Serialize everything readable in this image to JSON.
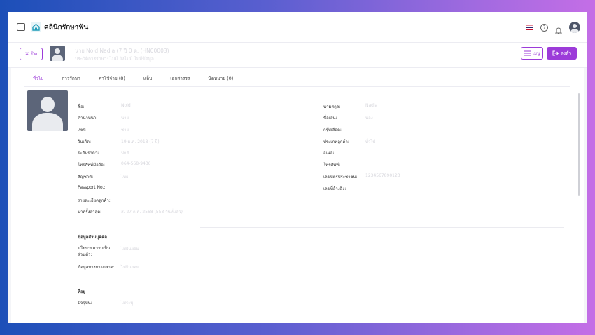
{
  "app": {
    "title": "คลินิกรักษาฟัน"
  },
  "header": {
    "icons": [
      "sidebar-toggle-icon",
      "home-icon",
      "thai-flag-icon",
      "help-icon",
      "bell-icon",
      "user-avatar-icon"
    ]
  },
  "patient": {
    "close_label": "ปิด",
    "name_line": "นาย Noid Nadia (7 ปี 0 ด. (HN00003)",
    "sub_line": "ประวัติการรักษา: ไม่มี ยังไม่มี ไม่มีข้อมูล",
    "menu_label": "เมนู",
    "send_label": "ส่งตัว"
  },
  "tabs": [
    "ทั่วไป",
    "การรักษา",
    "ค่าใช้จ่าย (8)",
    "แล็บ",
    "เอกสารรร",
    "นัดหมาย (0)"
  ],
  "fields_left": [
    {
      "label": "ชื่อ:",
      "value": "Noid"
    },
    {
      "label": "คำนำหน้า:",
      "value": "นาย"
    },
    {
      "label": "เพศ:",
      "value": "ชาย"
    },
    {
      "label": "วันเกิด:",
      "value": "19 ม.ค. 2018 (7 ปี)"
    },
    {
      "label": "ระดับราคา:",
      "value": "ปกติ"
    },
    {
      "label": "โทรศัพท์มือถือ:",
      "value": "064-568-9436"
    },
    {
      "label": "สัญชาติ:",
      "value": "ไทย"
    },
    {
      "label": "Passport No.:",
      "value": ""
    },
    {
      "label": "รายละเอียดลูกค้า:",
      "value": ""
    },
    {
      "label": "มาครั้งล่าสุด:",
      "value": "ส. 27 ก.ค. 2568 (553 วันที่แล้ว)"
    }
  ],
  "fields_right": [
    {
      "label": "นามสกุล:",
      "value": "Nadia"
    },
    {
      "label": "ชื่อเล่น:",
      "value": "น้อง"
    },
    {
      "label": "กรุ๊ปเลือด:",
      "value": ""
    },
    {
      "label": "ประเภทลูกค้า:",
      "value": "ทั่วไป"
    },
    {
      "label": "อีเมล:",
      "value": ""
    },
    {
      "label": "โทรศัพท์:",
      "value": ""
    },
    {
      "label": "เลขบัตรประชาชน:",
      "value": "1234567890123"
    },
    {
      "label": "เลขที่อ้างอิง:",
      "value": ""
    }
  ],
  "privacy": {
    "title": "ข้อมูลส่วนบุคคล",
    "policy_label": "นโยบายความเป็นส่วนตัว:",
    "policy_value": "ไม่ยินยอม",
    "marketing_label": "ข้อมูลทางการตลาด:",
    "marketing_value": "ไม่ยินยอม"
  },
  "address": {
    "title": "ที่อยู่",
    "current_label": "ปัจจุบัน:",
    "current_value": "ไม่ระบุ"
  }
}
